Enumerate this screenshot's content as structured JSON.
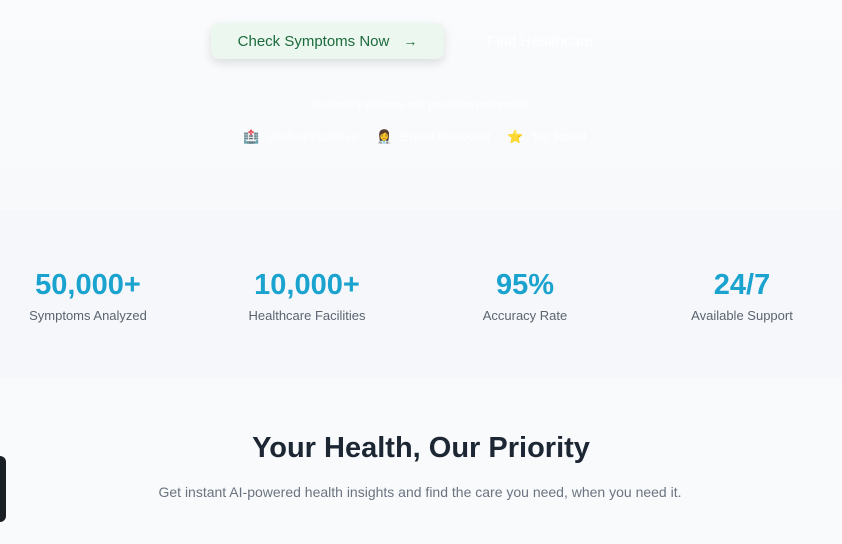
{
  "hero": {
    "cta_primary": {
      "label": "Check Symptoms Now",
      "arrow": "→"
    },
    "cta_secondary": {
      "label": "Find Healthcare"
    },
    "trust_line": "Trusted by patients and providers nationwide",
    "badges": [
      {
        "icon": "hospital-icon",
        "emoji": "🏥",
        "label": "Verified Facilities"
      },
      {
        "icon": "doctor-icon",
        "emoji": "👩‍⚕️",
        "label": "Expert Reviewed"
      },
      {
        "icon": "star-icon",
        "emoji": "⭐",
        "label": "Top Rated"
      }
    ]
  },
  "stats": [
    {
      "value": "50,000+",
      "label": "Symptoms Analyzed"
    },
    {
      "value": "10,000+",
      "label": "Healthcare Facilities"
    },
    {
      "value": "95%",
      "label": "Accuracy Rate"
    },
    {
      "value": "24/7",
      "label": "Available Support"
    }
  ],
  "priority": {
    "title": "Your Health, Our Priority",
    "subtitle": "Get instant AI-powered health insights and find the care you need, when you need it."
  },
  "colors": {
    "accent": "#1ba3cf",
    "cta_bg": "#ecf7ef",
    "cta_text": "#1c6b3d",
    "heading": "#1d2633"
  }
}
